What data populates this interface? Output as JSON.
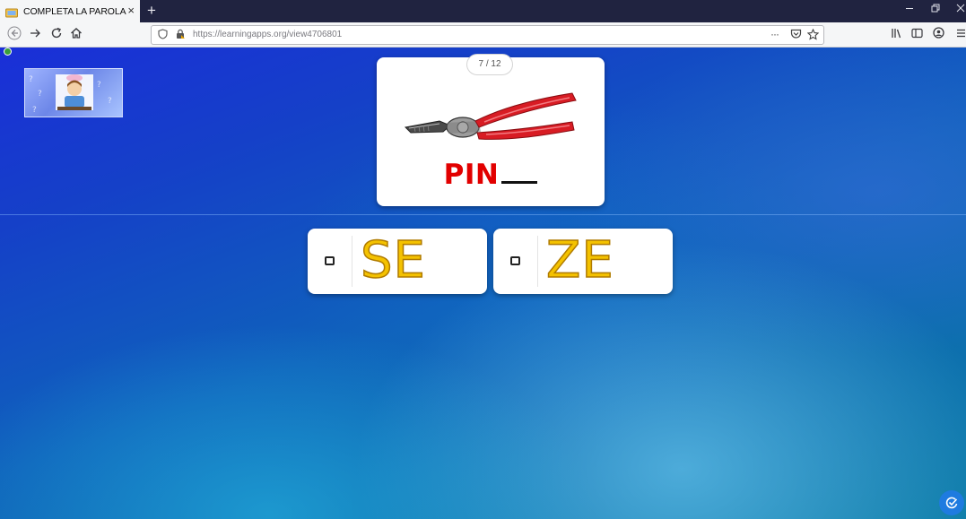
{
  "browser": {
    "tab_title": "COMPLETA LA PAROLA",
    "tab_close": "×",
    "new_tab": "+",
    "url": "https://learningapps.org/view4706801",
    "url_more": "···"
  },
  "exercise": {
    "counter": "7 / 12",
    "word_prefix": "PIN",
    "image_icon": "pliers-icon",
    "answers": [
      {
        "label": "SE"
      },
      {
        "label": "ZE"
      }
    ]
  },
  "colors": {
    "word": "#e20000",
    "answer_fill": "#f4c200",
    "answer_outline": "#b07b00",
    "check_button": "#1e7be0"
  }
}
